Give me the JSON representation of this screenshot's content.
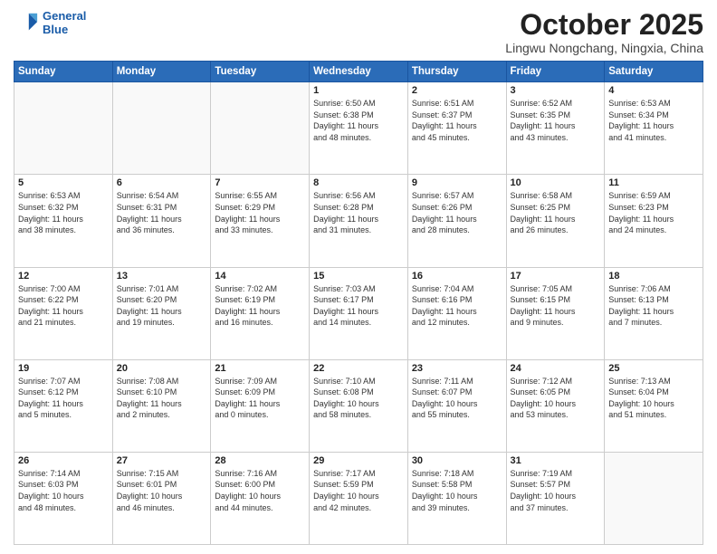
{
  "header": {
    "logo_line1": "General",
    "logo_line2": "Blue",
    "month": "October 2025",
    "location": "Lingwu Nongchang, Ningxia, China"
  },
  "weekdays": [
    "Sunday",
    "Monday",
    "Tuesday",
    "Wednesday",
    "Thursday",
    "Friday",
    "Saturday"
  ],
  "weeks": [
    [
      {
        "day": "",
        "info": ""
      },
      {
        "day": "",
        "info": ""
      },
      {
        "day": "",
        "info": ""
      },
      {
        "day": "1",
        "info": "Sunrise: 6:50 AM\nSunset: 6:38 PM\nDaylight: 11 hours\nand 48 minutes."
      },
      {
        "day": "2",
        "info": "Sunrise: 6:51 AM\nSunset: 6:37 PM\nDaylight: 11 hours\nand 45 minutes."
      },
      {
        "day": "3",
        "info": "Sunrise: 6:52 AM\nSunset: 6:35 PM\nDaylight: 11 hours\nand 43 minutes."
      },
      {
        "day": "4",
        "info": "Sunrise: 6:53 AM\nSunset: 6:34 PM\nDaylight: 11 hours\nand 41 minutes."
      }
    ],
    [
      {
        "day": "5",
        "info": "Sunrise: 6:53 AM\nSunset: 6:32 PM\nDaylight: 11 hours\nand 38 minutes."
      },
      {
        "day": "6",
        "info": "Sunrise: 6:54 AM\nSunset: 6:31 PM\nDaylight: 11 hours\nand 36 minutes."
      },
      {
        "day": "7",
        "info": "Sunrise: 6:55 AM\nSunset: 6:29 PM\nDaylight: 11 hours\nand 33 minutes."
      },
      {
        "day": "8",
        "info": "Sunrise: 6:56 AM\nSunset: 6:28 PM\nDaylight: 11 hours\nand 31 minutes."
      },
      {
        "day": "9",
        "info": "Sunrise: 6:57 AM\nSunset: 6:26 PM\nDaylight: 11 hours\nand 28 minutes."
      },
      {
        "day": "10",
        "info": "Sunrise: 6:58 AM\nSunset: 6:25 PM\nDaylight: 11 hours\nand 26 minutes."
      },
      {
        "day": "11",
        "info": "Sunrise: 6:59 AM\nSunset: 6:23 PM\nDaylight: 11 hours\nand 24 minutes."
      }
    ],
    [
      {
        "day": "12",
        "info": "Sunrise: 7:00 AM\nSunset: 6:22 PM\nDaylight: 11 hours\nand 21 minutes."
      },
      {
        "day": "13",
        "info": "Sunrise: 7:01 AM\nSunset: 6:20 PM\nDaylight: 11 hours\nand 19 minutes."
      },
      {
        "day": "14",
        "info": "Sunrise: 7:02 AM\nSunset: 6:19 PM\nDaylight: 11 hours\nand 16 minutes."
      },
      {
        "day": "15",
        "info": "Sunrise: 7:03 AM\nSunset: 6:17 PM\nDaylight: 11 hours\nand 14 minutes."
      },
      {
        "day": "16",
        "info": "Sunrise: 7:04 AM\nSunset: 6:16 PM\nDaylight: 11 hours\nand 12 minutes."
      },
      {
        "day": "17",
        "info": "Sunrise: 7:05 AM\nSunset: 6:15 PM\nDaylight: 11 hours\nand 9 minutes."
      },
      {
        "day": "18",
        "info": "Sunrise: 7:06 AM\nSunset: 6:13 PM\nDaylight: 11 hours\nand 7 minutes."
      }
    ],
    [
      {
        "day": "19",
        "info": "Sunrise: 7:07 AM\nSunset: 6:12 PM\nDaylight: 11 hours\nand 5 minutes."
      },
      {
        "day": "20",
        "info": "Sunrise: 7:08 AM\nSunset: 6:10 PM\nDaylight: 11 hours\nand 2 minutes."
      },
      {
        "day": "21",
        "info": "Sunrise: 7:09 AM\nSunset: 6:09 PM\nDaylight: 11 hours\nand 0 minutes."
      },
      {
        "day": "22",
        "info": "Sunrise: 7:10 AM\nSunset: 6:08 PM\nDaylight: 10 hours\nand 58 minutes."
      },
      {
        "day": "23",
        "info": "Sunrise: 7:11 AM\nSunset: 6:07 PM\nDaylight: 10 hours\nand 55 minutes."
      },
      {
        "day": "24",
        "info": "Sunrise: 7:12 AM\nSunset: 6:05 PM\nDaylight: 10 hours\nand 53 minutes."
      },
      {
        "day": "25",
        "info": "Sunrise: 7:13 AM\nSunset: 6:04 PM\nDaylight: 10 hours\nand 51 minutes."
      }
    ],
    [
      {
        "day": "26",
        "info": "Sunrise: 7:14 AM\nSunset: 6:03 PM\nDaylight: 10 hours\nand 48 minutes."
      },
      {
        "day": "27",
        "info": "Sunrise: 7:15 AM\nSunset: 6:01 PM\nDaylight: 10 hours\nand 46 minutes."
      },
      {
        "day": "28",
        "info": "Sunrise: 7:16 AM\nSunset: 6:00 PM\nDaylight: 10 hours\nand 44 minutes."
      },
      {
        "day": "29",
        "info": "Sunrise: 7:17 AM\nSunset: 5:59 PM\nDaylight: 10 hours\nand 42 minutes."
      },
      {
        "day": "30",
        "info": "Sunrise: 7:18 AM\nSunset: 5:58 PM\nDaylight: 10 hours\nand 39 minutes."
      },
      {
        "day": "31",
        "info": "Sunrise: 7:19 AM\nSunset: 5:57 PM\nDaylight: 10 hours\nand 37 minutes."
      },
      {
        "day": "",
        "info": ""
      }
    ]
  ]
}
